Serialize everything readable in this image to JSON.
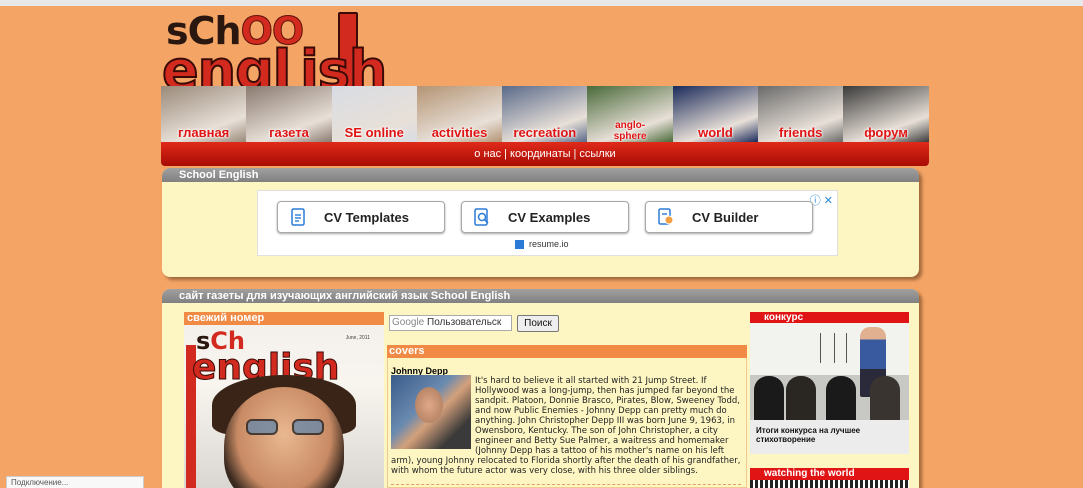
{
  "logo": {
    "line1_a": "sCh",
    "line1_b": "OO",
    "line2": "engl",
    "line2_b": "ish"
  },
  "nav": [
    {
      "label": "главная",
      "name": "nav-glavnaya",
      "color": "#9a8a7a"
    },
    {
      "label": "газета",
      "name": "nav-gazeta",
      "color": "#8a7a70"
    },
    {
      "label": "SE online",
      "name": "nav-se-online",
      "color": "#d8dce4"
    },
    {
      "label": "activities",
      "name": "nav-activities",
      "color": "#b49474"
    },
    {
      "label": "recreation",
      "name": "nav-recreation",
      "color": "#5a6a8a"
    },
    {
      "label": "anglo-\nsphere",
      "name": "nav-anglosphere",
      "color": "#4a6a3a"
    },
    {
      "label": "world",
      "name": "nav-world",
      "color": "#1a2a5a"
    },
    {
      "label": "friends",
      "name": "nav-friends",
      "color": "#6a6a6a"
    },
    {
      "label": "форум",
      "name": "nav-forum",
      "color": "#3a3a3a"
    }
  ],
  "links": {
    "about": "о нас",
    "coords": "координаты",
    "links": "ссылки",
    "sep": "|"
  },
  "panel1": {
    "title": "School English"
  },
  "ad": {
    "btn1": "CV Templates",
    "btn2": "CV Examples",
    "btn3": "CV Builder",
    "source": "resume.io"
  },
  "panel2": {
    "title": "сайт газеты для изучающих английский язык School English"
  },
  "issue": {
    "title": "свежий номер",
    "cover_line1_a": "s",
    "cover_line1_b": "Ch",
    "cover_line2": "english",
    "cover_small": "June, 2011"
  },
  "search": {
    "prefix": "Google",
    "placeholder": "Пользовательск",
    "button": "Поиск"
  },
  "covers": {
    "title": "covers",
    "article_title": "Johnny Depp",
    "article_text": "It's hard to believe it all started with 21 Jump Street. If Hollywood was a long-jump, then has jumped far beyond the sandpit. Platoon, Donnie Brasco, Pirates, Blow, Sweeney Todd, and now Public Enemies - Johnny Depp can pretty much do anything. John Christopher Depp III was born June 9, 1963, in Owensboro, Kentucky. The son of John Christopher, a city engineer and Betty Sue Palmer, a waitress and homemaker (Johnny Depp has a tattoo of his mother's name on his left arm), young Johnny relocated to Florida shortly after the death of his grandfather, with whom the future actor was very close, with his three older siblings."
  },
  "contest": {
    "title": "конкурс",
    "caption": "Итоги конкурса на лучшее стихотворение"
  },
  "watching": {
    "title": "watching the world"
  },
  "status": {
    "text": "Подключение..."
  }
}
